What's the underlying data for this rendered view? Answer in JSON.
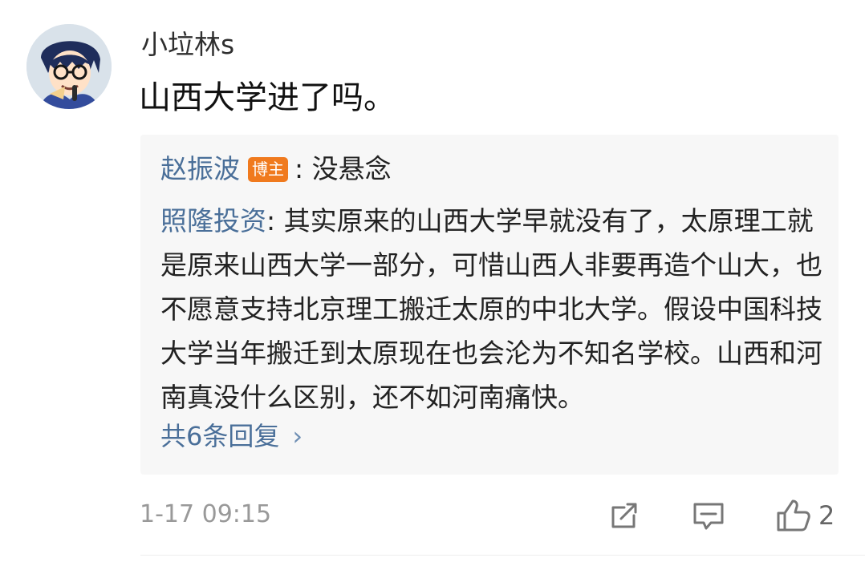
{
  "comment": {
    "avatar_icon": "anime-character-avatar",
    "username": "小垃林s",
    "text": "山西大学进了吗。"
  },
  "reply_preview": {
    "first_reply": {
      "name": "赵振波",
      "badge": "博主",
      "separator": ": ",
      "text": "没悬念"
    },
    "second_reply": {
      "name": "照隆投资",
      "separator": ": ",
      "text": "其实原来的山西大学早就没有了，太原理工就是原来山西大学一部分，可惜山西人非要再造个山大，也不愿意支持北京理工搬迁太原的中北大学。假设中国科技大学当年搬迁到太原现在也会沦为不知名学校。山西和河南真没什么区别，还不如河南痛快。"
    },
    "total_replies": "共6条回复",
    "chevron": "›"
  },
  "footer": {
    "timestamp": "1-17 09:15",
    "like_count": "2",
    "icons": {
      "share": "share-icon",
      "comment": "comment-icon",
      "like": "like-icon"
    }
  },
  "colors": {
    "link_blue": "#4a6f99",
    "badge_orange": "#f07a1e",
    "reply_background": "#f7f7f7",
    "meta_gray": "#999999"
  }
}
